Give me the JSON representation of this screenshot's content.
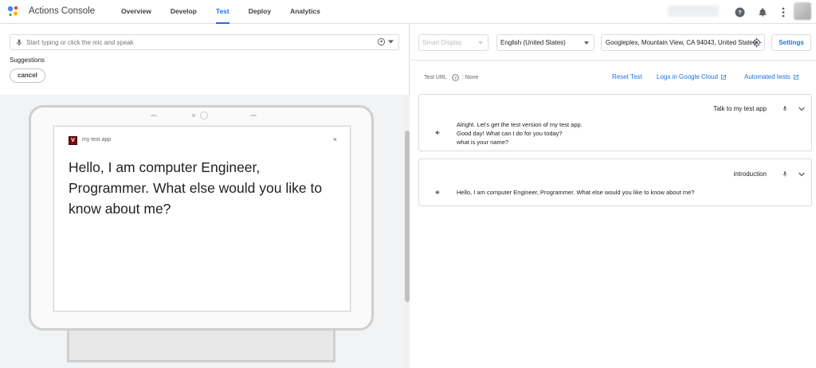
{
  "header": {
    "app_title": "Actions Console",
    "tabs": [
      {
        "label": "Overview",
        "active": false
      },
      {
        "label": "Develop",
        "active": false
      },
      {
        "label": "Test",
        "active": true
      },
      {
        "label": "Deploy",
        "active": false
      },
      {
        "label": "Analytics",
        "active": false
      }
    ],
    "icons": [
      "help-icon",
      "notifications-icon",
      "more-vert-icon"
    ]
  },
  "left": {
    "input_placeholder": "Start typing or click the mic and speak",
    "input_value": "",
    "suggestions_title": "Suggestions",
    "suggestions": [
      "cancel"
    ],
    "display": {
      "app_name": "my test app",
      "app_icon_letter": "V",
      "close": "×",
      "text": "Hello, I am computer Engineer, Programmer. What else would you like to know about me?"
    }
  },
  "right": {
    "surface_select": "Smart Display",
    "language_select": "English (United States)",
    "location": "Googleplex, Mountain View, CA 94043, United States",
    "settings_label": "Settings",
    "test_url_label": "Test URL",
    "test_url_value": ": None",
    "links": {
      "reset": "Reset Test",
      "logs": "Logs in Google Cloud",
      "automated": "Automated tests"
    },
    "cards": [
      {
        "title": "Talk to my test app",
        "lines": [
          "Alright. Let's get the test version of my test app.",
          "Good day! What can I do for you today?",
          "what is your name?"
        ]
      },
      {
        "title": "introduction",
        "lines": [
          "Hello, I am computer Engineer, Programmer. What else would you like to know about me?"
        ]
      }
    ]
  },
  "colors": {
    "accent": "#1a73e8",
    "border": "#dadce0",
    "simulator_bg": "#f1f3f4"
  }
}
